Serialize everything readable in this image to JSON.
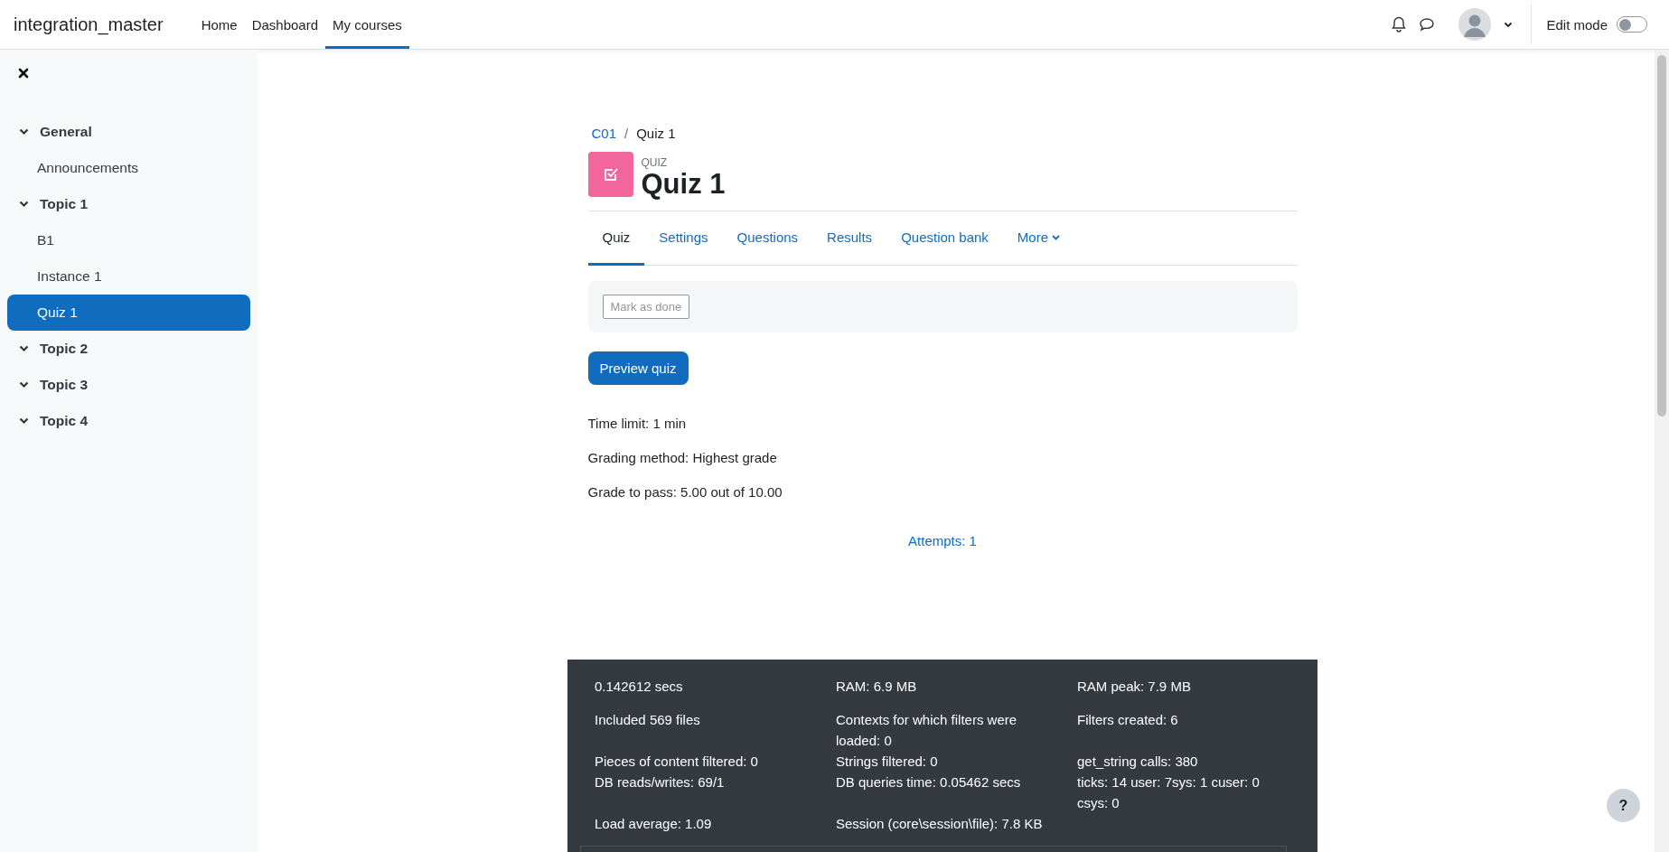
{
  "navbar": {
    "site_name": "integration_master",
    "links": [
      {
        "label": "Home",
        "selected": false
      },
      {
        "label": "Dashboard",
        "selected": false
      },
      {
        "label": "My courses",
        "selected": true
      }
    ],
    "edit_mode": {
      "label": "Edit mode",
      "on": false
    }
  },
  "sidebar": {
    "items": [
      {
        "label": "General",
        "kind": "section",
        "expanded": true,
        "selected": false
      },
      {
        "label": "Announcements",
        "kind": "activity",
        "selected": false
      },
      {
        "label": "Topic 1",
        "kind": "section",
        "expanded": true,
        "selected": false
      },
      {
        "label": "B1",
        "kind": "activity",
        "selected": false
      },
      {
        "label": "Instance 1",
        "kind": "activity",
        "selected": false
      },
      {
        "label": "Quiz 1",
        "kind": "activity",
        "selected": true
      },
      {
        "label": "Topic 2",
        "kind": "section",
        "expanded": true,
        "selected": false
      },
      {
        "label": "Topic 3",
        "kind": "section",
        "expanded": true,
        "selected": false
      },
      {
        "label": "Topic 4",
        "kind": "section",
        "expanded": true,
        "selected": false
      }
    ]
  },
  "breadcrumb": [
    {
      "label": "C01",
      "kind": "link"
    },
    {
      "label": "/",
      "kind": "separator"
    },
    {
      "label": "Quiz 1",
      "kind": "current"
    }
  ],
  "activity": {
    "type": "QUIZ",
    "title": "Quiz 1"
  },
  "tabs": [
    {
      "label": "Quiz",
      "selected": true
    },
    {
      "label": "Settings",
      "selected": false
    },
    {
      "label": "Questions",
      "selected": false
    },
    {
      "label": "Results",
      "selected": false
    },
    {
      "label": "Question bank",
      "selected": false
    },
    {
      "label": "More",
      "selected": false
    }
  ],
  "completion": {
    "button": "Mark as done",
    "disabled": true
  },
  "preview_button": "Preview quiz",
  "info": [
    "Time limit: 1 min",
    "Grading method: Highest grade",
    "Grade to pass: 5.00 out of 10.00"
  ],
  "attempts_link": "Attempts: 1",
  "performance": [
    [
      "0.142612 secs",
      "RAM: 6.9 MB",
      "RAM peak: 7.9 MB"
    ],
    [
      "Included 569 files",
      "Contexts for which filters were loaded: 0",
      "Filters created: 6"
    ],
    [
      "Pieces of content filtered: 0",
      "Strings filtered: 0",
      "get_string calls: 380"
    ],
    [
      "DB reads/writes: 69/1",
      "DB queries time: 0.05462 secs",
      "ticks: 14 user: 7sys: 1 cuser: 0 csys: 0"
    ],
    [
      "Load average: 1.09",
      "Session (core\\session\\file): 7.8 KB"
    ]
  ],
  "help_button": "?"
}
